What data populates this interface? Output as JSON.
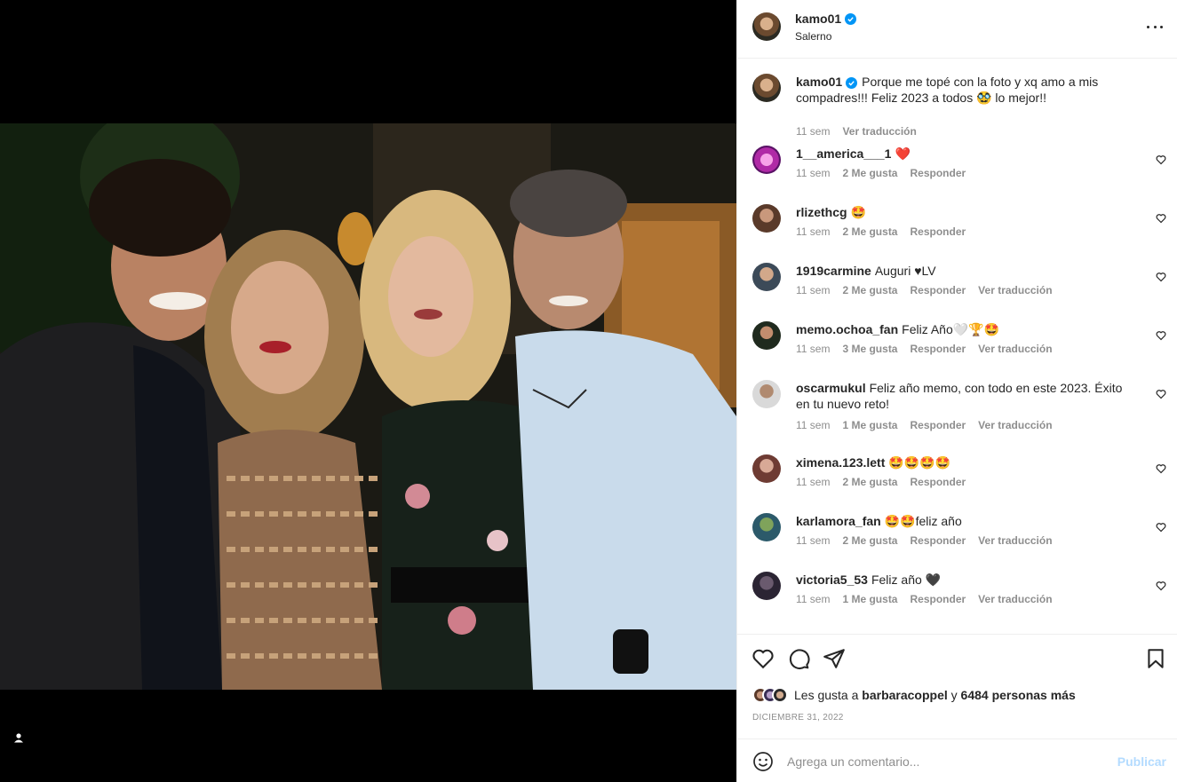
{
  "post": {
    "username": "kamo01",
    "location": "Salerno",
    "caption": "Porque me topé con la foto y xq amo a mis compadres!!! Feliz 2023 a todos 🥸 lo mejor!!",
    "caption_time": "11 sem",
    "caption_translate": "Ver traducción",
    "photo_description": "Four people posing together at night party"
  },
  "comments": [
    {
      "user": "1__america___1",
      "text": "❤️",
      "time": "11 sem",
      "likes": "2 Me gusta",
      "reply": "Responder",
      "translate": ""
    },
    {
      "user": "rlizethcg",
      "text": "🤩",
      "time": "11 sem",
      "likes": "2 Me gusta",
      "reply": "Responder",
      "translate": ""
    },
    {
      "user": "1919carmine",
      "text": "Auguri ♥LV",
      "time": "11 sem",
      "likes": "2 Me gusta",
      "reply": "Responder",
      "translate": "Ver traducción"
    },
    {
      "user": "memo.ochoa_fan",
      "text": "Feliz Año🤍🏆🤩",
      "time": "11 sem",
      "likes": "3 Me gusta",
      "reply": "Responder",
      "translate": "Ver traducción"
    },
    {
      "user": "oscarmukul",
      "text": "Feliz año memo, con todo en este 2023. Éxito en tu nuevo reto!",
      "time": "11 sem",
      "likes": "1 Me gusta",
      "reply": "Responder",
      "translate": "Ver traducción"
    },
    {
      "user": "ximena.123.lett",
      "text": "🤩🤩🤩🤩",
      "time": "11 sem",
      "likes": "2 Me gusta",
      "reply": "Responder",
      "translate": ""
    },
    {
      "user": "karlamora_fan",
      "text": "🤩🤩feliz año",
      "time": "11 sem",
      "likes": "2 Me gusta",
      "reply": "Responder",
      "translate": "Ver traducción"
    },
    {
      "user": "victoria5_53",
      "text": "Feliz año 🖤",
      "time": "11 sem",
      "likes": "1 Me gusta",
      "reply": "Responder",
      "translate": "Ver traducción"
    }
  ],
  "likes": {
    "prefix": "Les gusta a",
    "user": "barbaracoppel",
    "conj": "y",
    "others": "6484 personas más"
  },
  "date": "DICIEMBRE 31, 2022",
  "composer": {
    "placeholder": "Agrega un comentario...",
    "publish": "Publicar"
  },
  "colors": {
    "accent": "#0095f6",
    "publish_disabled": "#b3dbff",
    "muted": "#8e8e8e",
    "heart": "#ed4956"
  },
  "icons": [
    "verified-icon",
    "more-options-icon",
    "heart-icon",
    "comment-icon",
    "share-icon",
    "save-icon",
    "emoji-icon",
    "user-tag-icon"
  ]
}
